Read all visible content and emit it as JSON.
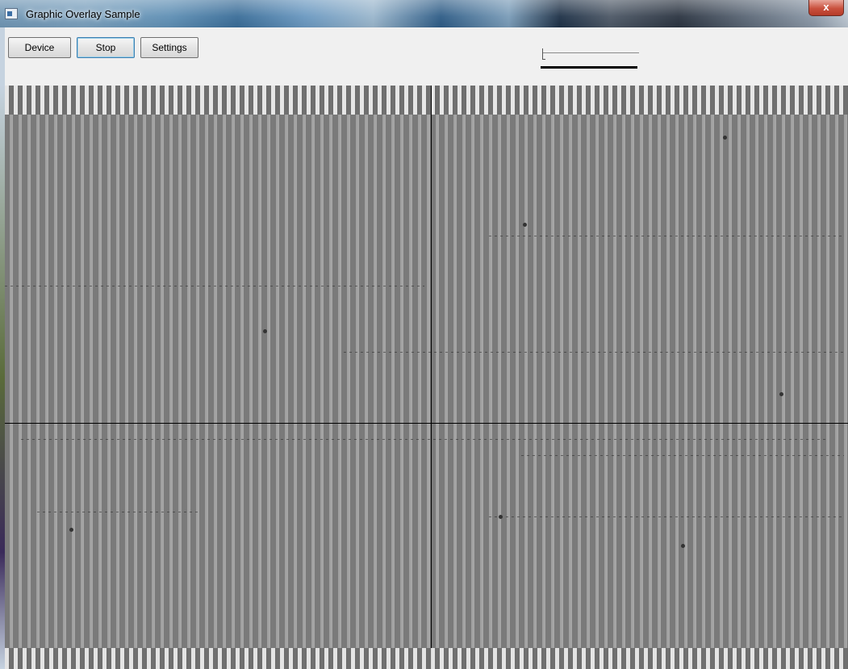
{
  "window": {
    "title": "Graphic Overlay Sample",
    "close_label": "x"
  },
  "toolbar": {
    "device_label": "Device",
    "stop_label": "Stop",
    "settings_label": "Settings",
    "slider_value": 0
  },
  "icons": {
    "app": "app-window-icon",
    "close": "close-icon"
  }
}
